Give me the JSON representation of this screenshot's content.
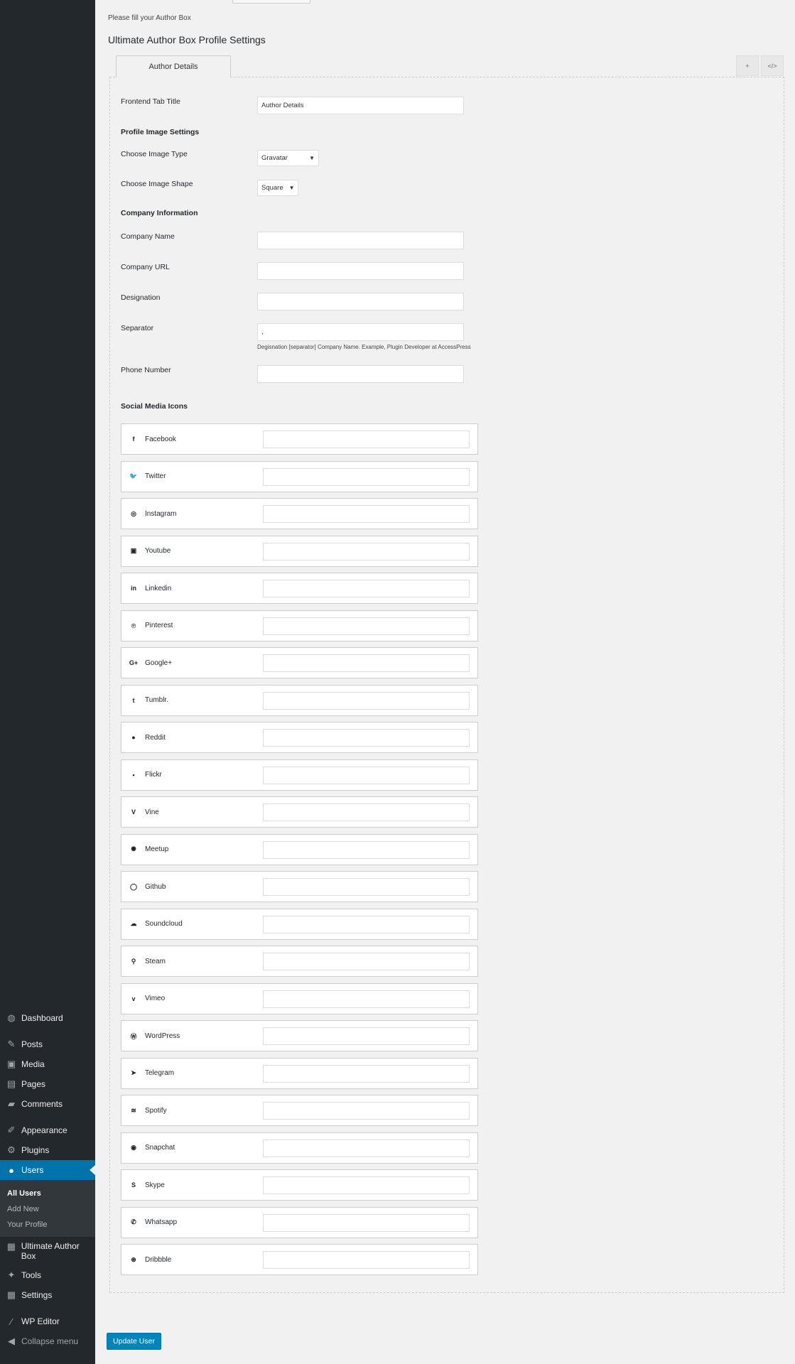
{
  "sidebar": {
    "items": [
      {
        "label": "Dashboard",
        "icon": "dashboard-icon",
        "glyph": "◍"
      },
      {
        "label": "Posts",
        "icon": "pin-icon",
        "glyph": "✎"
      },
      {
        "label": "Media",
        "icon": "media-icon",
        "glyph": "▣"
      },
      {
        "label": "Pages",
        "icon": "pages-icon",
        "glyph": "▤"
      },
      {
        "label": "Comments",
        "icon": "comments-icon",
        "glyph": "▰"
      },
      {
        "label": "Appearance",
        "icon": "appearance-icon",
        "glyph": "✐"
      },
      {
        "label": "Plugins",
        "icon": "plugins-icon",
        "glyph": "⚙"
      },
      {
        "label": "Users",
        "icon": "users-icon",
        "glyph": "●"
      },
      {
        "label": "Ultimate Author Box",
        "icon": "author-box-icon",
        "glyph": "▦"
      },
      {
        "label": "Tools",
        "icon": "tools-icon",
        "glyph": "✦"
      },
      {
        "label": "Settings",
        "icon": "settings-icon",
        "glyph": "▦"
      },
      {
        "label": "WP Editor",
        "icon": "editor-icon",
        "glyph": "∕"
      },
      {
        "label": "Collapse menu",
        "icon": "collapse-icon",
        "glyph": "◀"
      }
    ],
    "users_submenu": [
      "All Users",
      "Add New",
      "Your Profile"
    ]
  },
  "main": {
    "fill_note": "Please fill your Author Box",
    "title": "Ultimate Author Box Profile Settings",
    "tab_label": "Author Details",
    "tab_icons": [
      "+",
      "</>"
    ],
    "frontend_tab_title_label": "Frontend Tab Title",
    "frontend_tab_title_value": "Author Details",
    "profile_image_section": "Profile Image Settings",
    "image_type_label": "Choose Image Type",
    "image_type_value": "Gravatar",
    "image_shape_label": "Choose Image Shape",
    "image_shape_value": "Square",
    "company_section": "Company Information",
    "company_name_label": "Company Name",
    "company_url_label": "Company URL",
    "designation_label": "Designation",
    "separator_label": "Separator",
    "separator_value": ",",
    "separator_hint": "Degisnation [separator] Company Name. Example, Plugin Developer at AccessPress",
    "phone_label": "Phone Number",
    "social_section": "Social Media Icons",
    "update_button": "Update User"
  },
  "social": [
    {
      "name": "Facebook",
      "icon": "facebook-icon",
      "glyph": "f"
    },
    {
      "name": "Twitter",
      "icon": "twitter-icon",
      "glyph": "🐦"
    },
    {
      "name": "Instagram",
      "icon": "instagram-icon",
      "glyph": "◎"
    },
    {
      "name": "Youtube",
      "icon": "youtube-icon",
      "glyph": "▣"
    },
    {
      "name": "Linkedin",
      "icon": "linkedin-icon",
      "glyph": "in"
    },
    {
      "name": "Pinterest",
      "icon": "pinterest-icon",
      "glyph": "℗"
    },
    {
      "name": "Google+",
      "icon": "google-plus-icon",
      "glyph": "G+"
    },
    {
      "name": "Tumblr.",
      "icon": "tumblr-icon",
      "glyph": "t"
    },
    {
      "name": "Reddit",
      "icon": "reddit-icon",
      "glyph": "●"
    },
    {
      "name": "Flickr",
      "icon": "flickr-icon",
      "glyph": "▪"
    },
    {
      "name": "Vine",
      "icon": "vine-icon",
      "glyph": "V"
    },
    {
      "name": "Meetup",
      "icon": "meetup-icon",
      "glyph": "✺"
    },
    {
      "name": "Github",
      "icon": "github-icon",
      "glyph": "◯"
    },
    {
      "name": "Soundcloud",
      "icon": "soundcloud-icon",
      "glyph": "☁"
    },
    {
      "name": "Steam",
      "icon": "steam-icon",
      "glyph": "⚲"
    },
    {
      "name": "Vimeo",
      "icon": "vimeo-icon",
      "glyph": "v"
    },
    {
      "name": "WordPress",
      "icon": "wordpress-icon",
      "glyph": "Ⓦ"
    },
    {
      "name": "Telegram",
      "icon": "telegram-icon",
      "glyph": "➤"
    },
    {
      "name": "Spotify",
      "icon": "spotify-icon",
      "glyph": "≋"
    },
    {
      "name": "Snapchat",
      "icon": "snapchat-icon",
      "glyph": "◉"
    },
    {
      "name": "Skype",
      "icon": "skype-icon",
      "glyph": "S"
    },
    {
      "name": "Whatsapp",
      "icon": "whatsapp-icon",
      "glyph": "✆"
    },
    {
      "name": "Dribbble",
      "icon": "dribbble-icon",
      "glyph": "⊛"
    }
  ]
}
